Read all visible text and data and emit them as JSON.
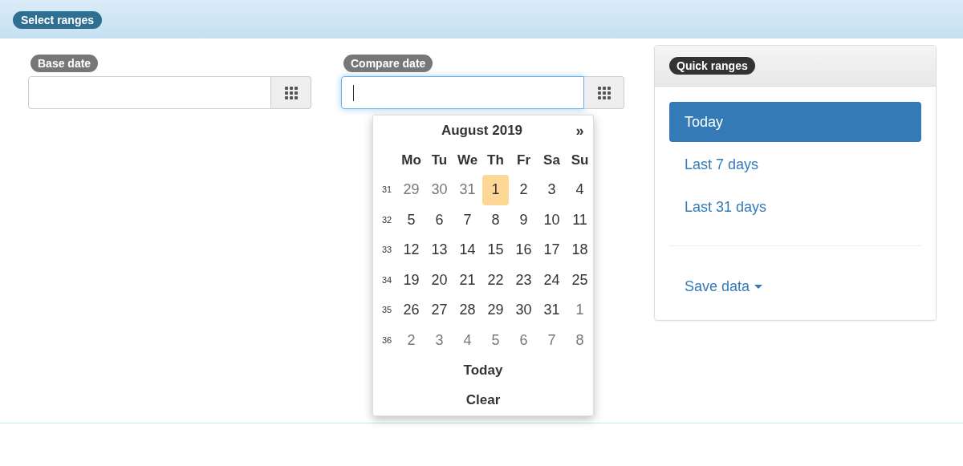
{
  "header": {
    "title": "Select ranges"
  },
  "fields": [
    {
      "label": "Base date",
      "focused": false
    },
    {
      "label": "Compare date",
      "focused": true
    }
  ],
  "calendar": {
    "title": "August 2019",
    "next": "»",
    "weekdays": [
      "Mo",
      "Tu",
      "We",
      "Th",
      "Fr",
      "Sa",
      "Su"
    ],
    "weeks": [
      {
        "number": "31",
        "days": [
          {
            "label": "29",
            "muted": true,
            "selected": false
          },
          {
            "label": "30",
            "muted": true,
            "selected": false
          },
          {
            "label": "31",
            "muted": true,
            "selected": false
          },
          {
            "label": "1",
            "muted": false,
            "selected": true
          },
          {
            "label": "2",
            "muted": false,
            "selected": false
          },
          {
            "label": "3",
            "muted": false,
            "selected": false
          },
          {
            "label": "4",
            "muted": false,
            "selected": false
          }
        ]
      },
      {
        "number": "32",
        "days": [
          {
            "label": "5",
            "muted": false,
            "selected": false
          },
          {
            "label": "6",
            "muted": false,
            "selected": false
          },
          {
            "label": "7",
            "muted": false,
            "selected": false
          },
          {
            "label": "8",
            "muted": false,
            "selected": false
          },
          {
            "label": "9",
            "muted": false,
            "selected": false
          },
          {
            "label": "10",
            "muted": false,
            "selected": false
          },
          {
            "label": "11",
            "muted": false,
            "selected": false
          }
        ]
      },
      {
        "number": "33",
        "days": [
          {
            "label": "12",
            "muted": false,
            "selected": false
          },
          {
            "label": "13",
            "muted": false,
            "selected": false
          },
          {
            "label": "14",
            "muted": false,
            "selected": false
          },
          {
            "label": "15",
            "muted": false,
            "selected": false
          },
          {
            "label": "16",
            "muted": false,
            "selected": false
          },
          {
            "label": "17",
            "muted": false,
            "selected": false
          },
          {
            "label": "18",
            "muted": false,
            "selected": false
          }
        ]
      },
      {
        "number": "34",
        "days": [
          {
            "label": "19",
            "muted": false,
            "selected": false
          },
          {
            "label": "20",
            "muted": false,
            "selected": false
          },
          {
            "label": "21",
            "muted": false,
            "selected": false
          },
          {
            "label": "22",
            "muted": false,
            "selected": false
          },
          {
            "label": "23",
            "muted": false,
            "selected": false
          },
          {
            "label": "24",
            "muted": false,
            "selected": false
          },
          {
            "label": "25",
            "muted": false,
            "selected": false
          }
        ]
      },
      {
        "number": "35",
        "days": [
          {
            "label": "26",
            "muted": false,
            "selected": false
          },
          {
            "label": "27",
            "muted": false,
            "selected": false
          },
          {
            "label": "28",
            "muted": false,
            "selected": false
          },
          {
            "label": "29",
            "muted": false,
            "selected": false
          },
          {
            "label": "30",
            "muted": false,
            "selected": false
          },
          {
            "label": "31",
            "muted": false,
            "selected": false
          },
          {
            "label": "1",
            "muted": true,
            "selected": false
          }
        ]
      },
      {
        "number": "36",
        "days": [
          {
            "label": "2",
            "muted": true,
            "selected": false
          },
          {
            "label": "3",
            "muted": true,
            "selected": false
          },
          {
            "label": "4",
            "muted": true,
            "selected": false
          },
          {
            "label": "5",
            "muted": true,
            "selected": false
          },
          {
            "label": "6",
            "muted": true,
            "selected": false
          },
          {
            "label": "7",
            "muted": true,
            "selected": false
          },
          {
            "label": "8",
            "muted": true,
            "selected": false
          }
        ]
      }
    ],
    "buttons": [
      "Today",
      "Clear"
    ]
  },
  "quick_ranges": {
    "title": "Quick ranges",
    "items": [
      {
        "label": "Today",
        "selected": true
      },
      {
        "label": "Last 7 days",
        "selected": false
      },
      {
        "label": "Last 31 days",
        "selected": false
      }
    ],
    "save_menu": {
      "label": "Save data"
    }
  }
}
